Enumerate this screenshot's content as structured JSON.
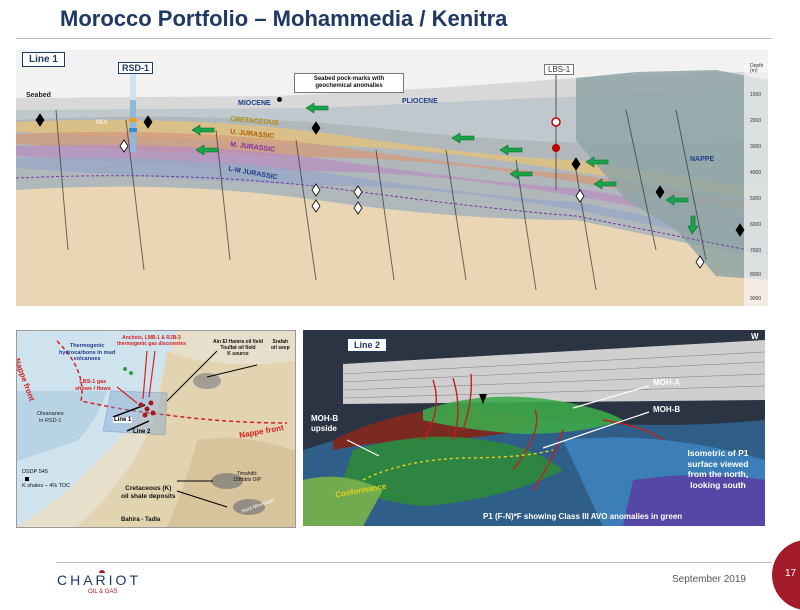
{
  "page": {
    "title": "Morocco Portfolio – Mohammedia / Kenitra",
    "date": "September 2019",
    "page_number": "17"
  },
  "logo": {
    "name": "CHARIOT",
    "sub": "OIL & GAS"
  },
  "line1": {
    "badge": "Line 1",
    "well_left": "RSD-1",
    "well_right": "LBS-1",
    "seabed": "Seabed",
    "callout": [
      "Seabed pock-marks with",
      "geochemical anomalies"
    ],
    "miocene": "MIOCENE",
    "pliocene": "PLIOCENE",
    "cretaceous": "CRETACEOUS",
    "u_jurassic": "U. JURASSIC",
    "m_jurassic": "M. JURASSIC",
    "lm_jurassic": "L-M JURASSIC",
    "nappe": "NAPPE",
    "moi": "MOI",
    "depth_title": [
      "Depth",
      "(m)"
    ],
    "depth_ticks": [
      "1000",
      "2000",
      "3000",
      "4000",
      "5000",
      "6000",
      "7000",
      "8000",
      "9000"
    ]
  },
  "map": {
    "nappe_front_left": "Nappe front",
    "nappe_front_right": "Nappe front",
    "thermogenic": [
      "Thermogenic",
      "hydrocarbons in mud",
      "volcanoes"
    ],
    "anchois": [
      "Anchois, LMB-1 & RJB-3",
      "thermogenic gas discoveries"
    ],
    "lbs1_gas": [
      "LBS-1 gas",
      "shows / flows"
    ],
    "oleananes": [
      "Oleananes",
      "in RSD-1"
    ],
    "ain_el_hamra": [
      "Ain El Hamra oil field",
      "Toulfat oil field",
      "K source"
    ],
    "srafah": [
      "Srafah",
      "oil seep"
    ],
    "line1": "Line 1",
    "line2": "Line 2",
    "dsdp": "DSDP 545",
    "kshales": "K shales – 4% TOC",
    "cretaceous_shale": [
      "Cretaceous (K)",
      "oil shale deposits"
    ],
    "timahdit": [
      "Timahdit:",
      "15Bbbls OIP"
    ],
    "haut_moulouya": "Haut Moulouya",
    "bahira": "Bahira - Tadla"
  },
  "line2": {
    "badge": "Line 2",
    "w": "W",
    "moh_a": "MOH-A",
    "moh_b": "MOH-B",
    "moh_b_upside": [
      "MOH-B",
      "upside"
    ],
    "conformance": "Conformance",
    "isometric": [
      "Isometric of P1",
      "surface viewed",
      "from the north,",
      "looking south"
    ],
    "caption": "P1 (F-N)*F showing Class III AVO anomalies in green"
  },
  "colors": {
    "title": "#1f3864",
    "accent": "#a31b2a",
    "arrow_green": "#1aa34a",
    "badge_border": "#1f3864"
  }
}
